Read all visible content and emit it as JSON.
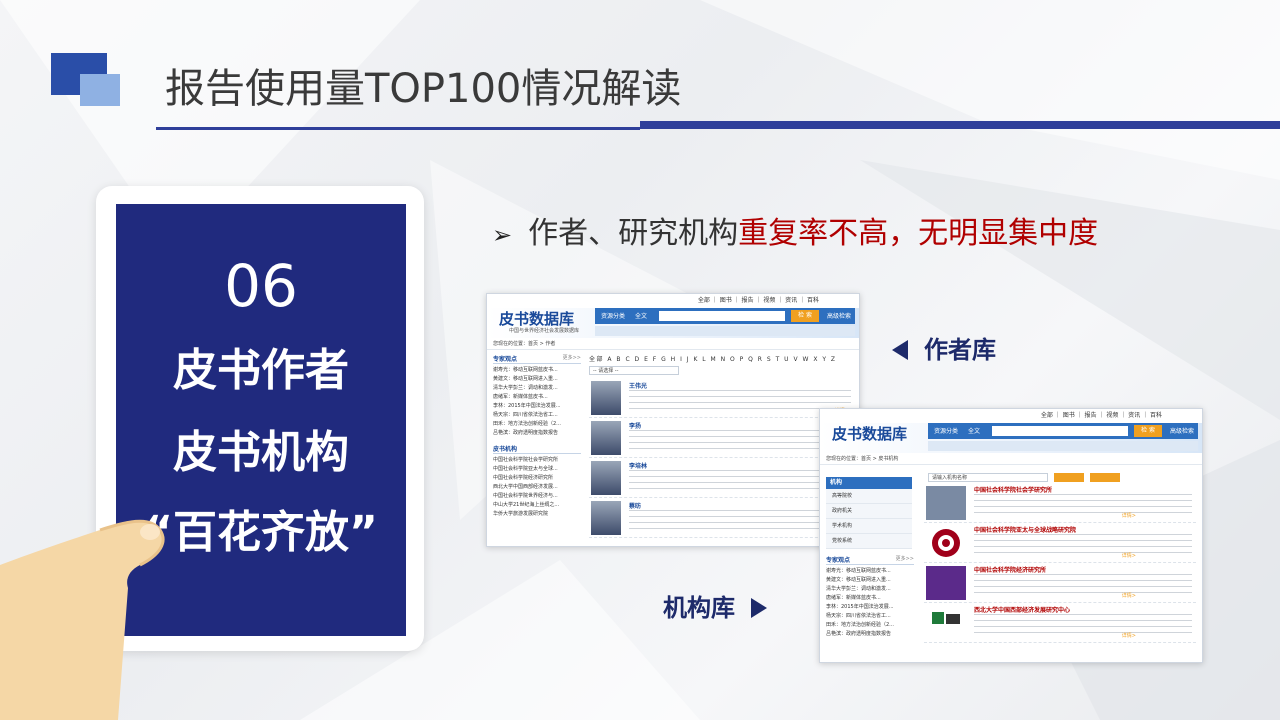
{
  "slide": {
    "title": "报告使用量TOP100情况解读",
    "tablet": {
      "number": "06",
      "line1": "皮书作者",
      "line2": "皮书机构",
      "line3": "“百花齐放”"
    },
    "bullet": {
      "marker": "➢",
      "plain": "作者、研究机构",
      "red1": "重复率不高",
      "sep": "，",
      "red2": "无明显集中度"
    },
    "label_author": "作者库",
    "label_institution": "机构库"
  },
  "screenshot_author": {
    "toplinks": "全部 ｜ 图书 ｜ 报告 ｜ 视频 ｜ 资讯 ｜ 百科",
    "logo": "皮书数据库",
    "logo_sub": "中国与世界经济社会发展数据库",
    "search_label": "资源分类",
    "search_scope": "全文",
    "search_button": "检 索",
    "advanced_button": "高级检索",
    "breadcrumb": "您现在的位置：首页 > 作者",
    "expert_heading": "专家观点",
    "more": "更多>>",
    "experts": [
      "谢寿光：移动互联网蓝皮书...",
      "黄建文：移动互联网进入重...",
      "清华大学彭兰：调动和激发...",
      "唐绪军：新媒体蓝皮书...",
      "李林：2015年中国法治发展...",
      "杨天宗：四川省依法治省工...",
      "田禾：地方法治创新经验（2...",
      "吕艳滨：政府透明度指数报告"
    ],
    "inst_heading": "皮书机构",
    "institutions": [
      "中国社会科学院社会学研究所",
      "中国社会科学院亚太与全球...",
      "中国社会科学院经济研究所",
      "西北大学中国西部经济发展...",
      "中国社会科学院世界经济与...",
      "中山大学21世纪海上丝绸之...",
      "华侨大学旅游发展研究院"
    ],
    "alphabet": "全部 A B C D E F G H I J K L M N O P Q R S T U V W X Y Z",
    "select_placeholder": "-- 请选择 --",
    "authors": [
      "王伟光",
      "李扬",
      "李培林",
      "蔡昉"
    ],
    "detail": "详情>"
  },
  "screenshot_institution": {
    "toplinks": "全部 ｜ 图书 ｜ 报告 ｜ 视频 ｜ 资讯 ｜ 百科",
    "logo": "皮书数据库",
    "search_label": "资源分类",
    "search_scope": "全文",
    "search_button": "检 索",
    "advanced_button": "高级检索",
    "breadcrumb": "您现在的位置：首页 > 皮书机构",
    "search_placeholder": "请输入机构名称",
    "nav_heading": "机构",
    "nav_items": [
      "高等院校",
      "政府机关",
      "学术机构",
      "党校系统"
    ],
    "expert_heading": "专家观点",
    "more": "更多>>",
    "experts": [
      "谢寿光：移动互联网蓝皮书...",
      "黄建文：移动互联网进入重...",
      "清华大学彭兰：调动和激发...",
      "唐绪军：新媒体蓝皮书...",
      "李林：2015年中国法治发展...",
      "杨天宗：四川省依法治省工...",
      "田禾：地方法治创新经验（2...",
      "吕艳滨：政府透明度指数报告"
    ],
    "institutions": [
      "中国社会科学院社会学研究所",
      "中国社会科学院亚太与全球战略研究院",
      "中国社会科学院经济研究所",
      "西北大学中国西部经济发展研究中心"
    ],
    "detail": "详情>"
  },
  "colors": {
    "brand_blue": "#202a7e",
    "accent_red": "#b00000",
    "title_bar": "#2f3f9a"
  }
}
